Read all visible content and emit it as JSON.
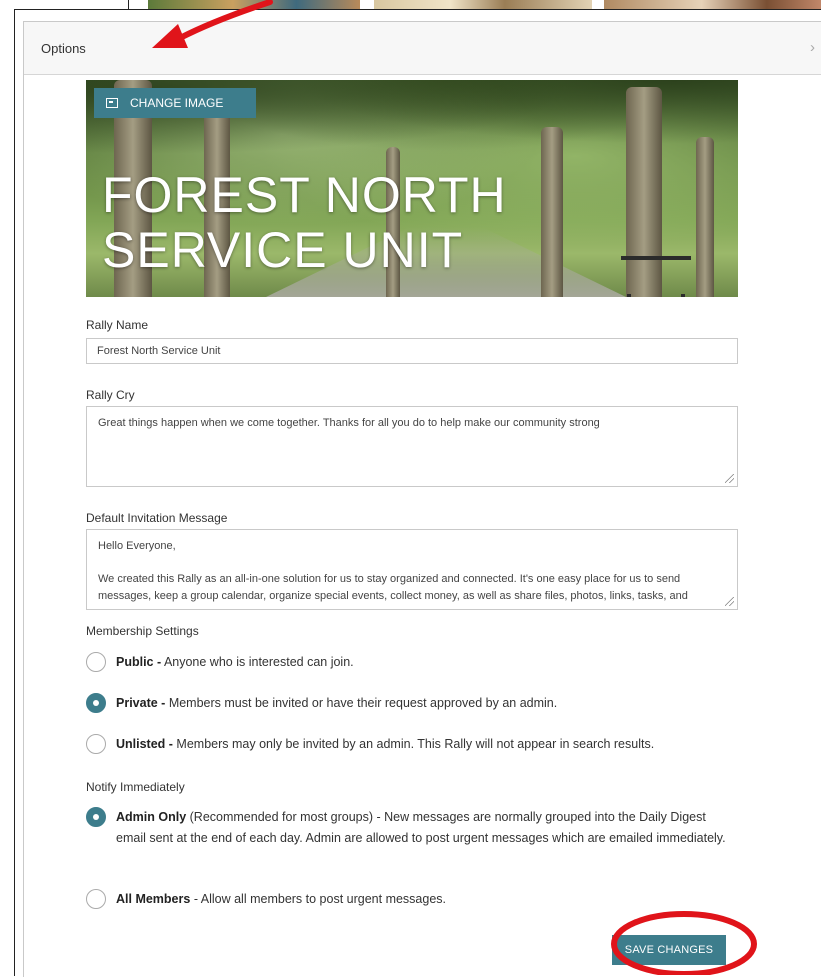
{
  "panel": {
    "title": "Options"
  },
  "banner": {
    "change_image_label": "CHANGE IMAGE",
    "title": "FOREST NORTH\nSERVICE UNIT"
  },
  "form": {
    "rally_name_label": "Rally Name",
    "rally_name_value": "Forest North Service Unit",
    "rally_cry_label": "Rally Cry",
    "rally_cry_value": "Great things happen when we come together. Thanks for all you do to help make our community strong",
    "invitation_label": "Default Invitation Message",
    "invitation_line1": "Hello Everyone,",
    "invitation_line2": "We created this Rally as an all-in-one solution for us to stay organized and connected. It's one easy place for us to send messages, keep a group calendar, organize special events, collect money, as well as share files, photos, links, tasks, and"
  },
  "membership": {
    "label": "Membership Settings",
    "options": [
      {
        "title": "Public -",
        "desc": " Anyone who is interested can join.",
        "checked": false
      },
      {
        "title": "Private -",
        "desc": " Members must be invited or have their request approved by an admin.",
        "checked": true
      },
      {
        "title": "Unlisted -",
        "desc": " Members may only be invited by an admin. This Rally will not appear in search results.",
        "checked": false
      }
    ]
  },
  "notify": {
    "label": "Notify Immediately",
    "options": [
      {
        "title": "Admin Only",
        "desc": " (Recommended for most groups) - New messages are normally grouped into the Daily Digest email sent at the end of each day. Admin are allowed to post urgent messages which are emailed immediately.",
        "checked": true
      },
      {
        "title": "All Members",
        "desc": " - Allow all members to post urgent messages.",
        "checked": false
      }
    ]
  },
  "actions": {
    "save_label": "SAVE CHANGES"
  },
  "colors": {
    "accent": "#3d7d8c",
    "annotation": "#e0141a"
  }
}
